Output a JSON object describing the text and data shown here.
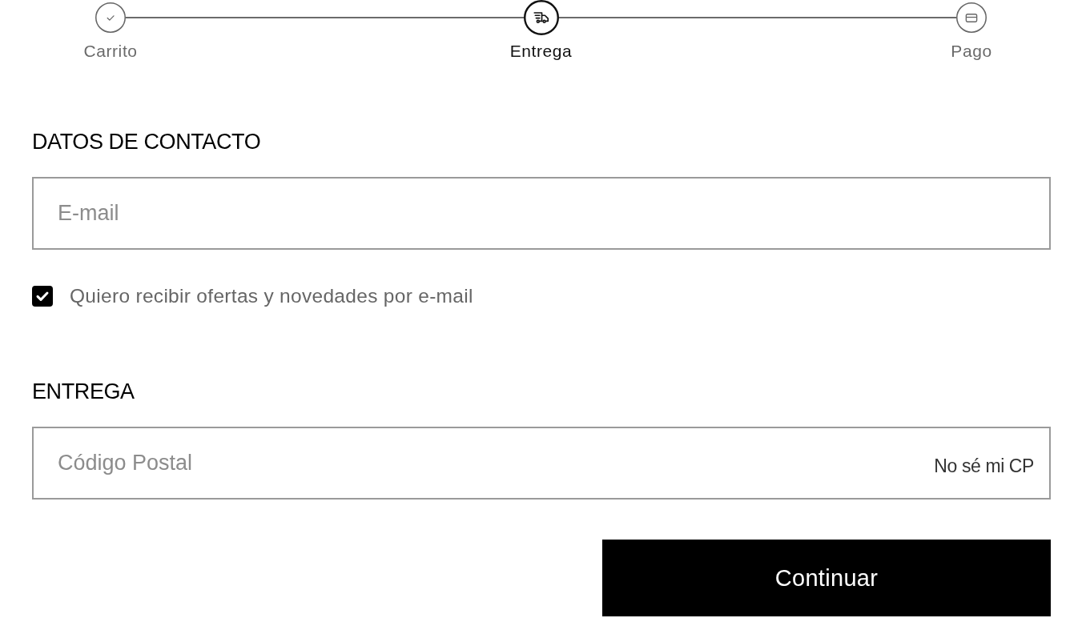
{
  "stepper": {
    "steps": [
      {
        "label": "Carrito",
        "completed": true,
        "current": false
      },
      {
        "label": "Entrega",
        "completed": false,
        "current": true
      },
      {
        "label": "Pago",
        "completed": false,
        "current": false
      }
    ]
  },
  "contact": {
    "heading": "DATOS DE CONTACTO",
    "email": {
      "placeholder": "E-mail"
    },
    "newsletter": {
      "label": "Quiero recibir ofertas y novedades por e-mail",
      "checked": true
    }
  },
  "delivery": {
    "heading": "ENTREGA",
    "postal_code": {
      "placeholder": "Código Postal"
    },
    "help_link": "No sé mi CP"
  },
  "continue_button": "Continuar"
}
